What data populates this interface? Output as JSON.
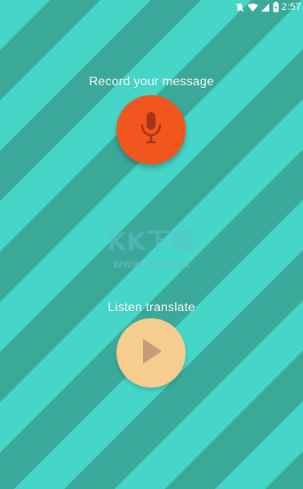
{
  "status_bar": {
    "time": "2:57",
    "icons": [
      "mute-icon",
      "wifi-icon",
      "signal-icon",
      "battery-icon"
    ]
  },
  "record": {
    "label": "Record your message",
    "icon": "microphone-icon",
    "color": "#f0561e"
  },
  "listen": {
    "label": "Listen translate",
    "icon": "play-icon",
    "color": "#f6cd8e"
  },
  "watermark": {
    "logo": "KK下载",
    "url": "www.kkx.net"
  },
  "colors": {
    "background_dark": "#3aa99a",
    "background_light": "#45d6c8"
  }
}
